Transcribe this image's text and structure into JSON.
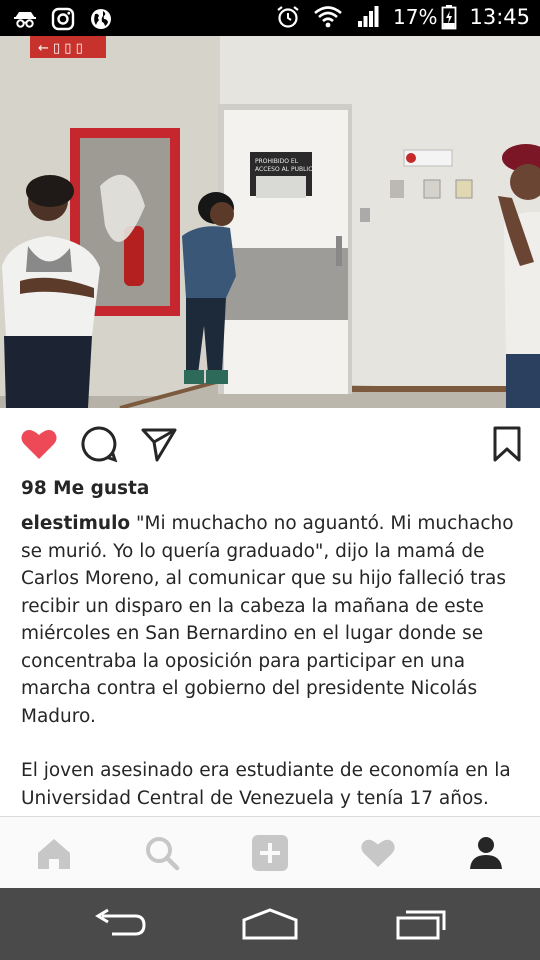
{
  "status_bar": {
    "battery": "17%",
    "time": "13:45"
  },
  "post": {
    "photo_sign_text": "PROHIBIDO EL ACCESO AL PUBLICO",
    "likes": "98 Me gusta",
    "username": "elestimulo",
    "caption_1": "\"Mi muchacho no aguantó. Mi muchacho se murió. Yo lo quería graduado\", dijo la mamá de Carlos Moreno, al comunicar que su hijo falleció tras recibir un disparo en la cabeza la mañana de este miércoles en San Bernardino en el lugar donde se concentraba la oposición para participar en una marcha contra el gobierno del presidente Nicolás Maduro.",
    "caption_2": "El joven asesinado era estudiante de economía en la Universidad Central de Venezuela y tenía 17 años."
  },
  "icons": {
    "like": "heart-icon",
    "comment": "comment-icon",
    "share": "send-icon",
    "save": "bookmark-icon",
    "nav": [
      "home-icon",
      "search-icon",
      "add-icon",
      "activity-heart-icon",
      "profile-icon"
    ],
    "system": [
      "back-icon",
      "home-button-icon",
      "recents-icon"
    ]
  },
  "colors": {
    "like_red": "#ed4956",
    "text": "#262626",
    "nav_inactive": "#c7c7c7",
    "nav_active": "#262626",
    "android_bar": "#4a4a4a"
  }
}
